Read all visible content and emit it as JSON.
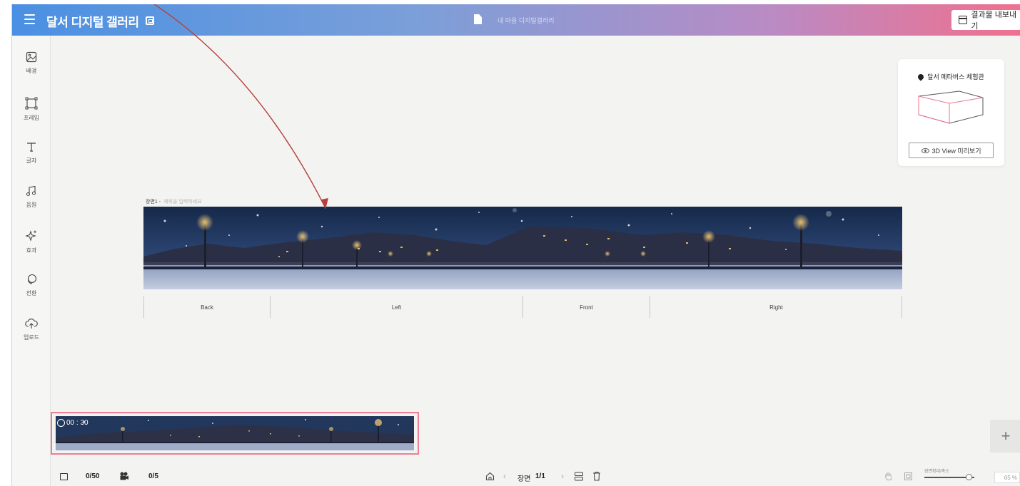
{
  "header": {
    "app_title": "달서 디지털 갤러리",
    "document_name": "내 마음 디지털갤러리",
    "export_label": "결과물 내보내기"
  },
  "sidebar": {
    "items": [
      {
        "label": "배경",
        "icon": "image-icon"
      },
      {
        "label": "프레임",
        "icon": "frame-icon"
      },
      {
        "label": "글자",
        "icon": "text-icon"
      },
      {
        "label": "음원",
        "icon": "music-icon"
      },
      {
        "label": "효과",
        "icon": "sparkle-icon"
      },
      {
        "label": "전환",
        "icon": "transition-icon"
      },
      {
        "label": "업로드",
        "icon": "upload-icon"
      }
    ]
  },
  "scene": {
    "label": "장면1 -",
    "title_placeholder": "제목을 입력하세요",
    "faces": [
      "Back",
      "Left",
      "Front",
      "Right"
    ]
  },
  "metaverse": {
    "title": "달서 메타버스 체험관",
    "view_button": "3D View 미리보기"
  },
  "timeline": {
    "duration": "00 : 30"
  },
  "bottom_bar": {
    "image_count": "0/50",
    "video_count": "0/5",
    "scene_label": "장면",
    "scene_page": "1/1",
    "zoom_label": "장면확대/축소",
    "zoom_value": "65 %",
    "zoom_level_percent": 65
  },
  "colors": {
    "header_start": "#4a90e2",
    "header_end": "#f0708e",
    "thumb_border": "#ee7e94",
    "annotation_arrow": "#b5413a"
  }
}
